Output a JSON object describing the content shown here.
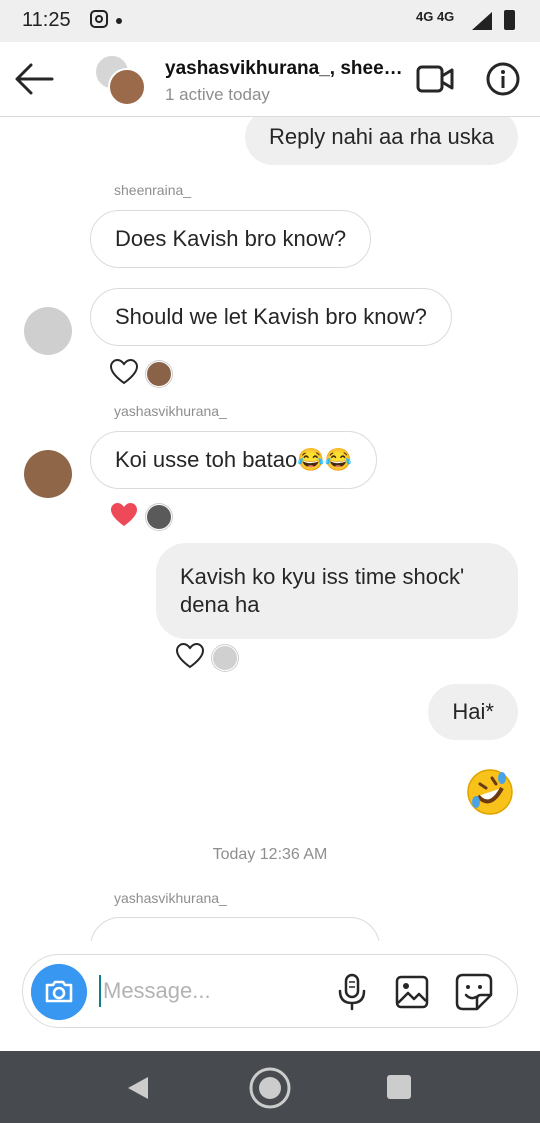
{
  "status_bar": {
    "time": "11:25",
    "network": "4G 4G"
  },
  "header": {
    "title": "yashasvikhurana_, sheenraina_",
    "subtitle": "1 active today"
  },
  "messages": {
    "m1": "Reply nahi aa rha uska",
    "sender1": "sheenraina_",
    "m2": "Does Kavish bro know?",
    "m3": "Should we let Kavish bro know?",
    "sender2": "yashasvikhurana_",
    "m4": "Koi usse toh batao😂😂",
    "m5_line1": "Kavish ko kyu iss time shock'",
    "m5_line2": "dena ha",
    "m6": "Hai*",
    "timestamp": "Today 12:36 AM",
    "sender3": "yashasvikhurana_"
  },
  "composer": {
    "placeholder": "Message..."
  },
  "colors": {
    "accent": "#3897f0",
    "heart_red": "#ed4956",
    "bubble_out": "#efefef",
    "nav_bar": "#474b4f"
  },
  "icons": [
    "back-arrow-icon",
    "video-call-icon",
    "info-icon",
    "heart-icon",
    "camera-icon",
    "microphone-icon",
    "gallery-icon",
    "sticker-icon"
  ]
}
